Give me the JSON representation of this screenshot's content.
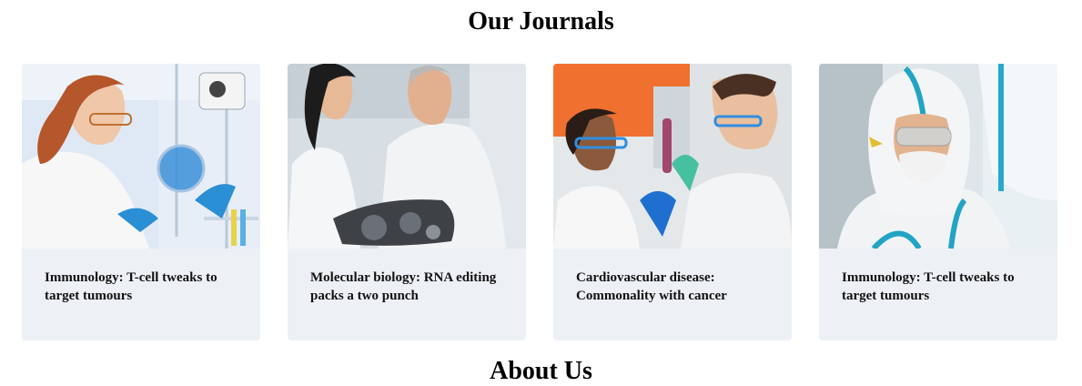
{
  "section": {
    "title": "Our Journals"
  },
  "journals": [
    {
      "title": "Immunology: T-cell tweaks to target tumours",
      "image": "scientist-lab-glassware-photo"
    },
    {
      "title": "Molecular biology: RNA editing packs a two punch",
      "image": "scientists-examining-engine-photo"
    },
    {
      "title": "Cardiovascular disease: Commonality with cancer",
      "image": "scientists-test-tube-photo"
    },
    {
      "title": "Immunology: T-cell tweaks to target tumours",
      "image": "hazmat-suit-scientist-photo"
    }
  ],
  "next_section": {
    "title": "About Us"
  }
}
